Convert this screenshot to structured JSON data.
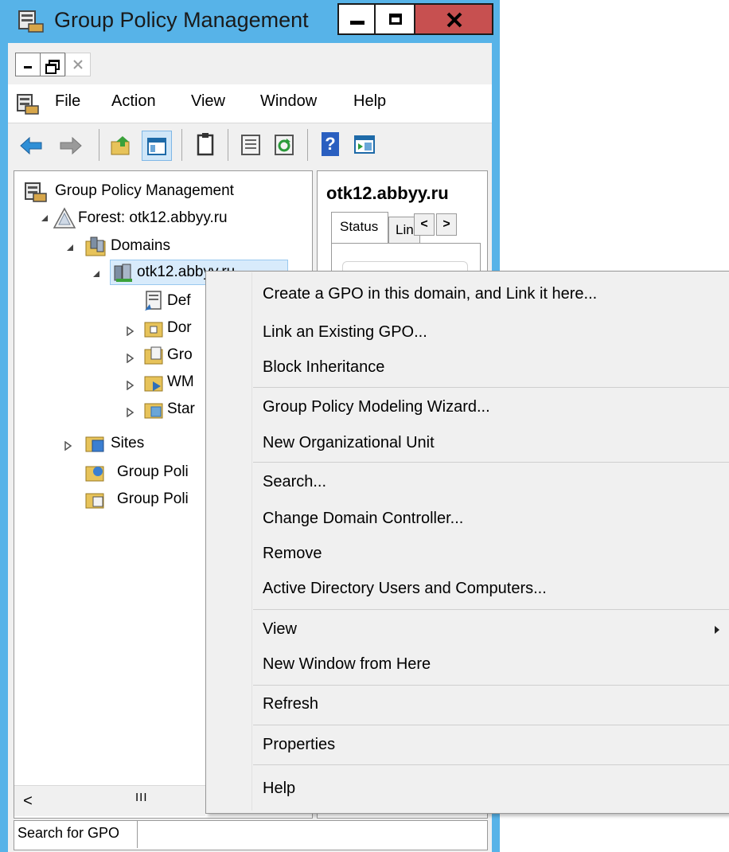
{
  "window": {
    "title": "Group Policy Management"
  },
  "menubar": {
    "items": [
      "File",
      "Action",
      "View",
      "Window",
      "Help"
    ]
  },
  "tree": {
    "root": "Group Policy Management",
    "forest": "Forest: otk12.abbyy.ru",
    "domains": "Domains",
    "domain": "otk12.abbyy.ru",
    "children": [
      "Def",
      "Dor",
      "Gro",
      "WM",
      "Star"
    ],
    "sites": "Sites",
    "gp1": "Group Poli",
    "gp2": "Group Poli",
    "hscroll_thumb": "III"
  },
  "right_pane": {
    "heading": "otk12.abbyy.ru",
    "tab_status": "Status",
    "tab_links": "Lin"
  },
  "statusbar": {
    "search_label": "Search for GPO"
  },
  "context_menu": {
    "groups": [
      [
        "Create a GPO in this domain, and Link it here...",
        "Link an Existing GPO...",
        "Block Inheritance"
      ],
      [
        "Group Policy Modeling Wizard...",
        "New Organizational Unit"
      ],
      [
        "Search...",
        "Change Domain Controller...",
        "Remove",
        "Active Directory Users and Computers..."
      ],
      [
        "View",
        "New Window from Here"
      ],
      [
        "Refresh"
      ],
      [
        "Properties"
      ],
      [
        "Help"
      ]
    ]
  },
  "colors": {
    "frame": "#57b3e8",
    "close_button": "#c75050",
    "menu_bg": "#f0f0f0"
  },
  "icons": [
    "gpm-icon",
    "minimize-icon",
    "maximize-icon",
    "close-icon",
    "back-arrow-icon",
    "forward-arrow-icon",
    "up-folder-icon",
    "show-hide-tree-icon",
    "clipboard-icon",
    "export-icon",
    "refresh-icon",
    "help-icon",
    "forest-icon",
    "domains-icon",
    "domain-icon",
    "submenu-arrow-icon"
  ]
}
